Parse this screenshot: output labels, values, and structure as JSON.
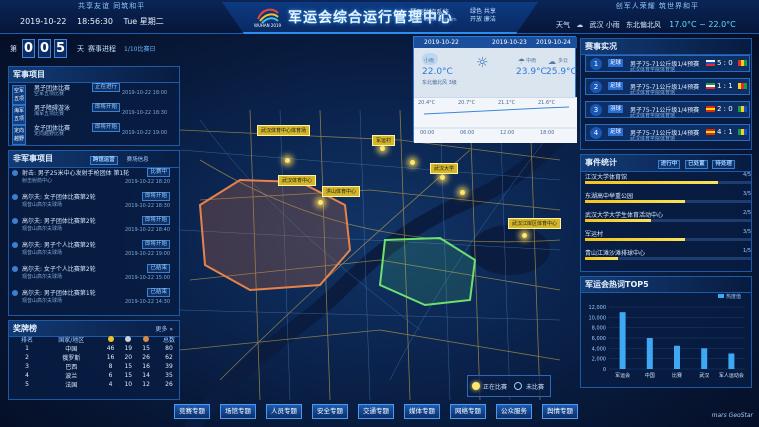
{
  "header": {
    "slogan_left": "共享友谊  同筑和平",
    "slogan_right": "创军人荣耀  筑世界和平",
    "date": "2019-10-22",
    "time": "18:56:30",
    "weekday": "Tue 星期二",
    "title": "军运会综合运行管理中心",
    "subtitle_cn": "慧眼数控系统",
    "subtitle_en": "Wise Sight System",
    "tag_line1": "绿色 共享",
    "tag_line2": "开放 廉洁",
    "logo_text": "WUHAN 2019",
    "weather_label": "天气",
    "weather_city": "武汉 小雨",
    "weather_wind": "东北偏北风",
    "weather_range": "17.0°C ~ 22.0°C"
  },
  "counter": {
    "prefix": "第",
    "digits": [
      "0",
      "0",
      "5"
    ],
    "suffix": "天",
    "progress_label": "赛事进程",
    "progress_value": "1/10比赛日"
  },
  "military_events": {
    "title": "军事项目",
    "rows": [
      {
        "sport": "空军五项",
        "event": "男子团体比赛",
        "status": "正在进行",
        "place": "空军五项比赛",
        "time": "2019-10-22 18:00"
      },
      {
        "sport": "海军五项",
        "event": "男子障碍游泳",
        "status": "即将开始",
        "place": "海军五项比赛",
        "time": "2019-10-22 18:30"
      },
      {
        "sport": "定向越野",
        "event": "女子团体比赛",
        "status": "即将开始",
        "place": "定向越野比赛",
        "time": "2019-10-22 19:00"
      }
    ]
  },
  "nonmilitary_events": {
    "title": "非军事项目",
    "tab1": "跨馆运营",
    "tab2": "赛场信息",
    "rows": [
      {
        "event": "射击: 男子25米中心发射手枪团体 第1轮",
        "status": "比赛中",
        "place": "射击射箭中心",
        "time": "2019-10-22 18:20"
      },
      {
        "event": "高尔夫: 女子团体比赛第2轮",
        "status": "即将开始",
        "place": "观音山高尔夫球场",
        "time": "2019-10-22 18:30"
      },
      {
        "event": "高尔夫: 男子团体比赛第2轮",
        "status": "即将开始",
        "place": "观音山高尔夫球场",
        "time": "2019-10-22 18:40"
      },
      {
        "event": "高尔夫: 男子个人比赛第2轮",
        "status": "即将开始",
        "place": "观音山高尔夫球场",
        "time": "2019-10-22 19:00"
      },
      {
        "event": "高尔夫: 女子个人比赛第2轮",
        "status": "已结束",
        "place": "观音山高尔夫球场",
        "time": "2019-10-22 15:00"
      },
      {
        "event": "高尔夫: 男子团体比赛第1轮",
        "status": "已结束",
        "place": "观音山高尔夫球场",
        "time": "2019-10-22 14:30"
      }
    ]
  },
  "medal_table": {
    "title": "奖牌榜",
    "more": "更多 »",
    "headers": [
      "排名",
      "国家/地区",
      "金",
      "银",
      "铜",
      "总数"
    ],
    "rows": [
      [
        "1",
        "中国",
        "46",
        "19",
        "15",
        "80"
      ],
      [
        "2",
        "俄罗斯",
        "16",
        "20",
        "26",
        "62"
      ],
      [
        "3",
        "巴西",
        "8",
        "15",
        "16",
        "39"
      ],
      [
        "4",
        "波兰",
        "6",
        "15",
        "14",
        "35"
      ],
      [
        "5",
        "法国",
        "4",
        "10",
        "12",
        "26"
      ]
    ]
  },
  "weather_card": {
    "dates": [
      "2019-10-22",
      "2019-10-23",
      "2019-10-24"
    ],
    "today_label": "小雨",
    "today_temp": "22.0°C",
    "today_wind": "东北偏北风",
    "today_level": "3级",
    "d2_label": "中雨",
    "d2_temp": "23.9°C",
    "d3_label": "多云",
    "d3_temp": "25.9°C",
    "hour_temps": [
      "20.4°C",
      "20.7°C",
      "21.1°C",
      "21.6°C"
    ],
    "hours": [
      "00:00",
      "06:00",
      "12:00",
      "18:00"
    ]
  },
  "results": {
    "title": "赛事实况",
    "rows": [
      {
        "n": "1",
        "sport": "足球",
        "event": "男子75-71公斤级1/4预赛",
        "place": "武汉体育学院体育馆",
        "score": "5 : 0"
      },
      {
        "n": "2",
        "sport": "足球",
        "event": "男子75-71公斤级1/4预赛",
        "place": "武汉体育学院体育馆",
        "score": "1 : 1"
      },
      {
        "n": "3",
        "sport": "羽球",
        "event": "男子75-71公斤级1/4预赛",
        "place": "武汉体育学院体育馆",
        "score": "2 : 0"
      },
      {
        "n": "4",
        "sport": "足球",
        "event": "男子75-71公斤级1/4预赛",
        "place": "武汉体育学院体育馆",
        "score": "4 : 1"
      }
    ]
  },
  "event_stats": {
    "title": "事件统计",
    "tabs": [
      "进行中",
      "已处置",
      "待处理"
    ],
    "rows": [
      {
        "name": "江汉大学体育馆",
        "value": "4/5",
        "pct": 0.8
      },
      {
        "name": "东湖高中举重公园",
        "value": "3/5",
        "pct": 0.6
      },
      {
        "name": "武汉大学大学生体育活动中心",
        "value": "2/5",
        "pct": 0.4
      },
      {
        "name": "军运村",
        "value": "3/5",
        "pct": 0.6
      },
      {
        "name": "青山江滩沙滩排球中心",
        "value": "1/5",
        "pct": 0.2
      }
    ]
  },
  "hot_words": {
    "title": "军运会热词TOP5",
    "legend": "热度值",
    "y_ticks": [
      "12,000",
      "10,000",
      "8,000",
      "6,000",
      "4,000",
      "2,000",
      "0"
    ]
  },
  "chart_data": {
    "type": "bar",
    "title": "军运会热词TOP5",
    "categories": [
      "军运会",
      "中国",
      "比赛",
      "武汉",
      "军人运动会"
    ],
    "series": [
      {
        "name": "热度值",
        "values": [
          11000,
          6000,
          4500,
          4000,
          3000
        ]
      }
    ],
    "ylim": [
      0,
      12000
    ]
  },
  "map": {
    "labels": [
      "武汉体育中心体育场",
      "武汉体育中心",
      "洪山体育中心",
      "军运村",
      "武汉大学",
      "武汉江岸区体育中心"
    ],
    "legend_active": "正在比赛",
    "legend_idle": "未比赛"
  },
  "nav": [
    "竞赛专题",
    "场馆专题",
    "人员专题",
    "安全专题",
    "交通专题",
    "媒体专题",
    "网络专题",
    "公众服务",
    "舆情专题"
  ],
  "footer_brand": "mars GeoStar"
}
